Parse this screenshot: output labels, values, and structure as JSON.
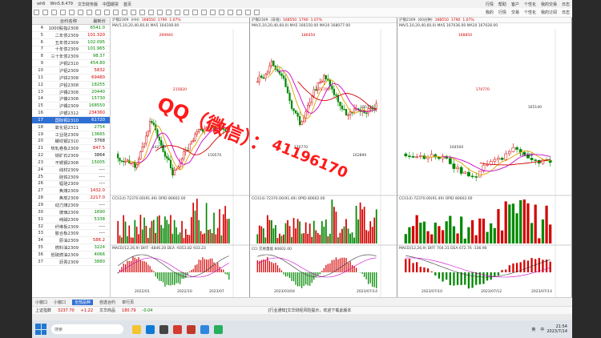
{
  "window": {
    "title_left": "wh6",
    "version": "Win5.8.479",
    "menu_items": [
      "文华财务版",
      "中国期货",
      "首页"
    ],
    "controls": [
      "行情",
      "帮助",
      "客户",
      "个性化",
      "我的交易",
      "日志"
    ]
  },
  "toolbar": {
    "nav_items": [
      "我的",
      "行情",
      "交易",
      "个性化",
      "我的订阅",
      "日志"
    ]
  },
  "left_list": {
    "headers": [
      "合约名称",
      "最新价"
    ],
    "rows": [
      {
        "num": "4",
        "name": "1000股指2308",
        "price": "6541.0",
        "dir": "dn"
      },
      {
        "num": "5",
        "name": "二年债2309",
        "price": "101.320",
        "dir": "up"
      },
      {
        "num": "6",
        "name": "五年债2309",
        "price": "102.095",
        "dir": "dn"
      },
      {
        "num": "7",
        "name": "十年债2309",
        "price": "101.965",
        "dir": "dn"
      },
      {
        "num": "8",
        "name": "三十年债2309",
        "price": "98.37",
        "dir": "dn"
      },
      {
        "num": "9",
        "name": "沪铜2310",
        "price": "454.80",
        "dir": "dn"
      },
      {
        "num": "10",
        "name": "沪铝2309",
        "price": "5832",
        "dir": "up"
      },
      {
        "num": "11",
        "name": "沪锌2308",
        "price": "69480",
        "dir": "up"
      },
      {
        "num": "12",
        "name": "沪铅2308",
        "price": "18255",
        "dir": "dn"
      },
      {
        "num": "13",
        "name": "沪锡2308",
        "price": "20440",
        "dir": "dn"
      },
      {
        "num": "14",
        "name": "沪镍2308",
        "price": "15730",
        "dir": "dn"
      },
      {
        "num": "15",
        "name": "沪锡2309",
        "price": "168550",
        "dir": "dn"
      },
      {
        "num": "16",
        "name": "沪银2312",
        "price": "234360",
        "dir": "up"
      },
      {
        "num": "17",
        "name": "国际铜2310",
        "price": "61720",
        "dir": "up",
        "selected": true
      },
      {
        "num": "18",
        "name": "氧化铝2311",
        "price": "2754",
        "dir": "dn"
      },
      {
        "num": "19",
        "name": "工业硅2309",
        "price": "13665",
        "dir": "dn"
      },
      {
        "num": "20",
        "name": "螺纹钢2310",
        "price": "3768",
        "dir": "fl"
      },
      {
        "num": "21",
        "name": "热轧卷板2309",
        "price": "847.5",
        "dir": "up"
      },
      {
        "num": "22",
        "name": "铁矿石2309",
        "price": "3864",
        "dir": "fl"
      },
      {
        "num": "23",
        "name": "不锈钢2308",
        "price": "15005",
        "dir": "dn"
      },
      {
        "num": "24",
        "name": "线材2309",
        "price": "----",
        "dir": "fl"
      },
      {
        "num": "25",
        "name": "硅铁2309",
        "price": "----",
        "dir": "fl"
      },
      {
        "num": "26",
        "name": "锰硅2309",
        "price": "----",
        "dir": "fl"
      },
      {
        "num": "27",
        "name": "焦煤2309",
        "price": "1432.0",
        "dir": "up"
      },
      {
        "num": "28",
        "name": "焦炭2309",
        "price": "2217.0",
        "dir": "up"
      },
      {
        "num": "29",
        "name": "动力煤2309",
        "price": "----",
        "dir": "fl"
      },
      {
        "num": "30",
        "name": "玻璃2309",
        "price": "1690",
        "dir": "dn"
      },
      {
        "num": "31",
        "name": "纯碱2309",
        "price": "5338",
        "dir": "dn"
      },
      {
        "num": "32",
        "name": "纤维板2309",
        "price": "----",
        "dir": "fl"
      },
      {
        "num": "33",
        "name": "胶合板2309",
        "price": "----",
        "dir": "fl"
      },
      {
        "num": "34",
        "name": "原油2309",
        "price": "586.2",
        "dir": "up"
      },
      {
        "num": "35",
        "name": "燃料油2309",
        "price": "3224",
        "dir": "dn"
      },
      {
        "num": "36",
        "name": "低硫燃油2309",
        "price": "4066",
        "dir": "dn"
      },
      {
        "num": "37",
        "name": "沥青2309",
        "price": "3880",
        "dir": "dn"
      }
    ]
  },
  "panels": [
    {
      "header": [
        "沪锡2309",
        "(HH)",
        "168550",
        "1790",
        "1.07%"
      ],
      "ma_line": "MA(5,10,20,40,60,0)  MA5 164108.00",
      "labels": [
        "269940",
        "215820",
        "142500",
        "150570"
      ],
      "cci_header": "CCI(14)  72370.00(91.49)  OPID 80602.00",
      "macd_header": "MACD(12,26,9)  DIFF -4846.20  DEA -9353.82  933.23",
      "date_left": "2022/01",
      "date_mid": "2022/10",
      "date_right": "2023/07"
    },
    {
      "header": [
        "沪锡2309",
        "(日线)",
        "168550",
        "1790",
        "1.07%"
      ],
      "ma_line": "MA(5,10,20,40,60,0)  MA5 166150.00  MA10 168077.00",
      "labels": [
        "186450",
        "171700",
        "170770",
        "162890",
        "155790"
      ],
      "cci_header": "CCI(14)  72370.00(91.49)  OPID 80602.00",
      "macd_header": "CCI  交易量能  80602.00",
      "date_left": "2023/03/04",
      "date_right": "2023/07/14"
    },
    {
      "header": [
        "沪锡2309",
        "(60分钟)",
        "168550",
        "1790",
        "1.07%"
      ],
      "ma_line": "MA(5,10,20,40,60,0)  MA5 167036.00  MA10 167028.00",
      "labels": [
        "168850",
        "170770",
        "164500",
        "162130",
        "165140"
      ],
      "cci_header": "CCI(14)  72370.00(91.49)  OPID 80602.00",
      "macd_header": "MACD(12,26,9)  DIFF 704.31  DEA 672.76  -336.90",
      "date_left": "2023/07/10",
      "date_mid": "2023/07/12",
      "date_right": "2023/07/14"
    }
  ],
  "watermark": {
    "line1": "QQ（微信）：",
    "line2": "41196170"
  },
  "bottom_tabs": [
    "小窗口",
    "小窗口",
    "全部品种",
    "自选合约",
    "单行页"
  ],
  "statusbar": {
    "left": "上证指数",
    "value1": "3237.70",
    "chg1": "+1.22",
    "label2": "文华商品",
    "value2": "180.79",
    "chg2": "-0.04",
    "msg": "[行业通知]文华财经风险提示，欢迎下载此版本"
  },
  "taskbar": {
    "search_placeholder": "搜索",
    "tray": [
      "英",
      "中"
    ],
    "time": "21:54",
    "date": "2023/7/14"
  }
}
